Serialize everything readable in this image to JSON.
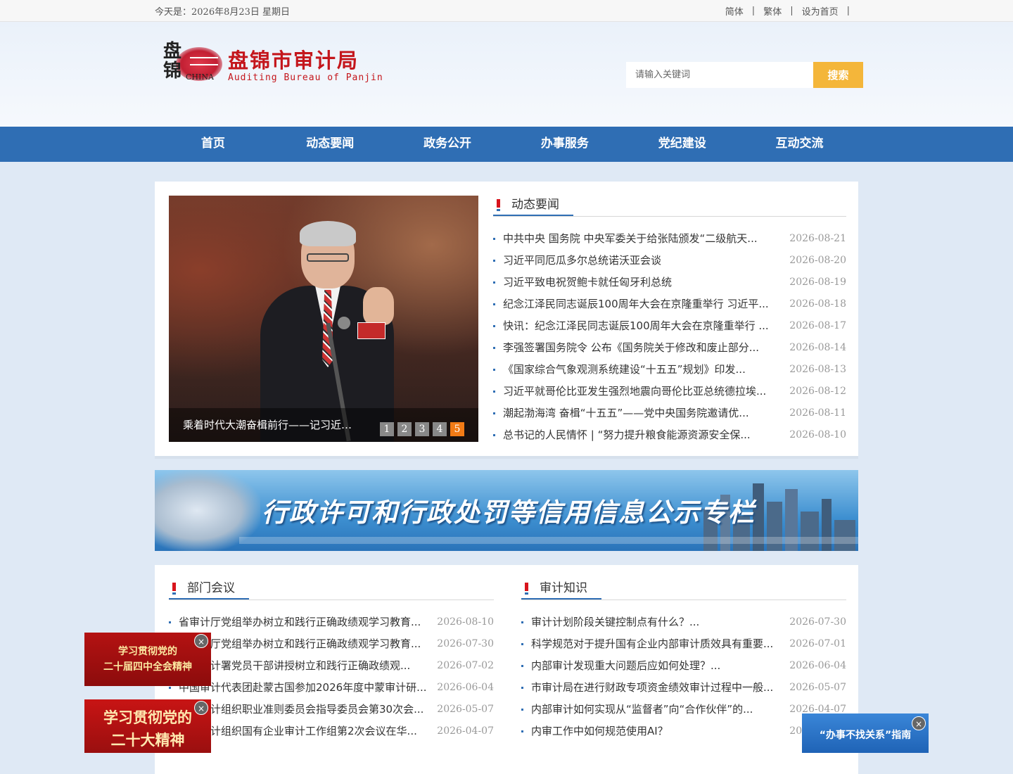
{
  "topbar": {
    "date": "今天是：2026年8月23日  星期日",
    "links": [
      "简体",
      "繁体",
      "设为首页"
    ],
    "sep": "|"
  },
  "logo": {
    "seal_text": "盘锦",
    "seal_sub": "CHINA",
    "title_zh": "盘锦市审计局",
    "title_en": "Auditing Bureau of Panjin"
  },
  "search": {
    "placeholder": "请输入关键词",
    "button": "搜索"
  },
  "nav": [
    "首页",
    "动态要闻",
    "政务公开",
    "办事服务",
    "党纪建设",
    "互动交流"
  ],
  "slider": {
    "caption": "乘着时代大潮奋楫前行——记习近平总书记",
    "pages": [
      "1",
      "2",
      "3",
      "4",
      "5"
    ],
    "active": "5"
  },
  "news": {
    "title": "动态要闻",
    "items": [
      {
        "t": "中共中央 国务院 中央军委关于给张陆颁发“二级航天...",
        "d": "2026-08-21"
      },
      {
        "t": "习近平同厄瓜多尔总统诺沃亚会谈",
        "d": "2026-08-20"
      },
      {
        "t": "习近平致电祝贺鲍卡就任匈牙利总统",
        "d": "2026-08-19"
      },
      {
        "t": "纪念江泽民同志诞辰100周年大会在京隆重举行 习近平...",
        "d": "2026-08-18"
      },
      {
        "t": "快讯：纪念江泽民同志诞辰100周年大会在京隆重举行 ...",
        "d": "2026-08-17"
      },
      {
        "t": "李强签署国务院令 公布《国务院关于修改和废止部分...",
        "d": "2026-08-14"
      },
      {
        "t": "《国家综合气象观测系统建设“十五五”规划》印发...",
        "d": "2026-08-13"
      },
      {
        "t": "习近平就哥伦比亚发生强烈地震向哥伦比亚总统德拉埃...",
        "d": "2026-08-12"
      },
      {
        "t": "潮起渤海湾 奋楫“十五五”——党中央国务院邀请优...",
        "d": "2026-08-11"
      },
      {
        "t": "总书记的人民情怀 | “努力提升粮食能源资源安全保...",
        "d": "2026-08-10"
      }
    ]
  },
  "banner": {
    "text": "行政许可和行政处罚等信用信息公示专栏"
  },
  "meetings": {
    "title": "部门会议",
    "items": [
      {
        "t": "省审计厅党组举办树立和践行正确政绩观学习教育...",
        "d": "2026-08-10"
      },
      {
        "t": "省审计厅党组举办树立和践行正确政绩观学习教育...",
        "d": "2026-07-30"
      },
      {
        "t": "中国审计署党员干部讲授树立和践行正确政绩观...",
        "d": "2026-07-02"
      },
      {
        "t": "中国审计代表团赴蒙古国参加2026年度中蒙审计研...",
        "d": "2026-06-04"
      },
      {
        "t": "中国审计组织职业准则委员会指导委员会第30次会...",
        "d": "2026-05-07"
      },
      {
        "t": "中国审计组织国有企业审计工作组第2次会议在华...",
        "d": "2026-04-07"
      }
    ]
  },
  "knowledge": {
    "title": "审计知识",
    "items": [
      {
        "t": "审计计划阶段关键控制点有什么？...",
        "d": "2026-07-30"
      },
      {
        "t": "科学规范对于提升国有企业内部审计质效具有重要...",
        "d": "2026-07-01"
      },
      {
        "t": "内部审计发现重大问题后应如何处理？...",
        "d": "2026-06-04"
      },
      {
        "t": "市审计局在进行财政专项资金绩效审计过程中一般...",
        "d": "2026-05-07"
      },
      {
        "t": "内部审计如何实现从“监督者”向“合作伙伴”的...",
        "d": "2026-04-07"
      },
      {
        "t": "内审工作中如何规范使用AI？",
        "d": "2026-03-05"
      }
    ]
  },
  "floats": {
    "f1_line1": "学习贯彻党的",
    "f1_line2": "二十届四中全会精神",
    "f2_line1": "学习贯彻党的",
    "f2_line2": "二十大精神",
    "f3_line1": "“办事不找关系”指南",
    "close": "×"
  }
}
